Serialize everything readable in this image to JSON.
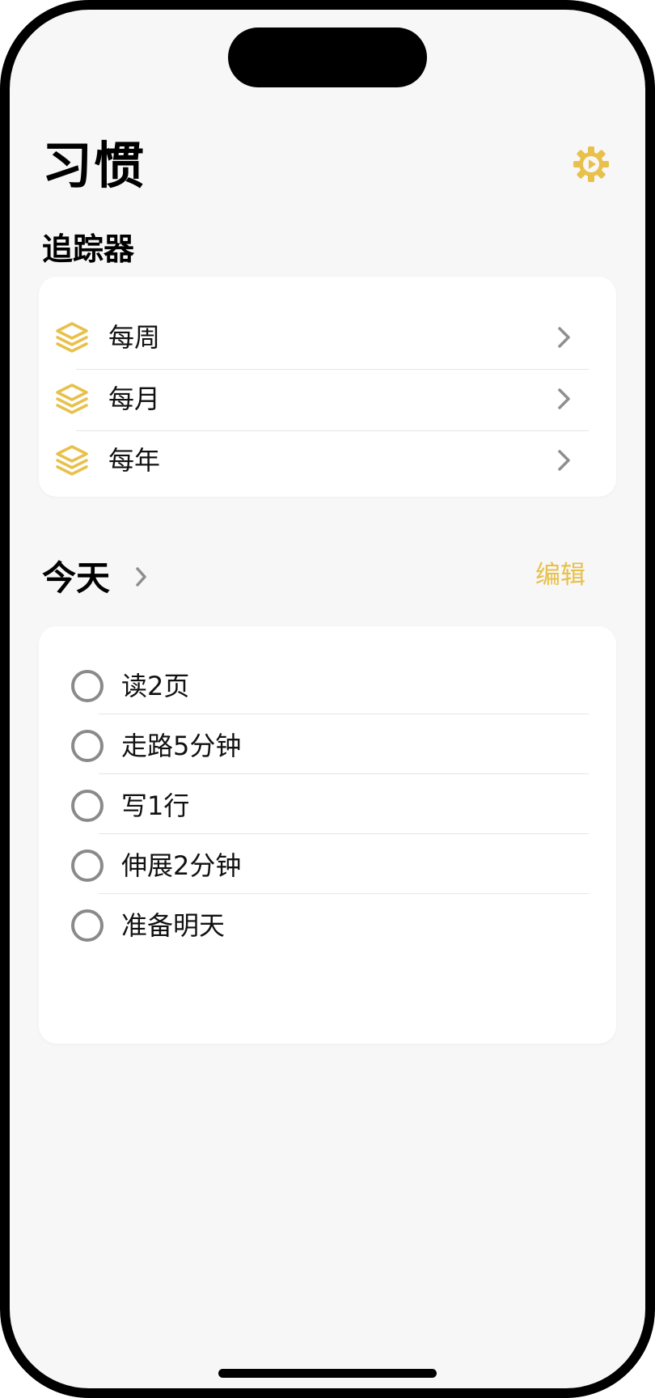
{
  "header": {
    "title": "习惯",
    "settings_icon": "gear-icon"
  },
  "trackers": {
    "title": "追踪器",
    "items": [
      {
        "label": "每周",
        "icon": "stack-icon"
      },
      {
        "label": "每月",
        "icon": "stack-icon"
      },
      {
        "label": "每年",
        "icon": "stack-icon"
      }
    ]
  },
  "today": {
    "title": "今天",
    "edit_label": "编辑",
    "tasks": [
      {
        "label": "读2页",
        "done": false
      },
      {
        "label": "走路5分钟",
        "done": false
      },
      {
        "label": "写1行",
        "done": false
      },
      {
        "label": "伸展2分钟",
        "done": false
      },
      {
        "label": "准备明天",
        "done": false
      }
    ]
  },
  "colors": {
    "accent": "#e8c04a",
    "background": "#f7f7f7",
    "card": "#ffffff",
    "chevron": "#8e8e8e",
    "circle": "#8a8a8a"
  }
}
